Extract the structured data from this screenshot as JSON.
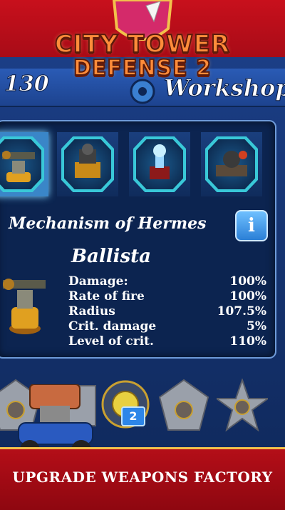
{
  "logo": {
    "line1": "CITY TOWER",
    "line2": "DEFENSE 2"
  },
  "header": {
    "coins": "130",
    "title": "Workshop"
  },
  "weapon_slots": [
    {
      "name": "ballista",
      "selected": true
    },
    {
      "name": "cannon",
      "selected": false
    },
    {
      "name": "tesla",
      "selected": false
    },
    {
      "name": "mortar",
      "selected": false
    }
  ],
  "detail": {
    "weapon_name": "Mechanism of Hermes",
    "info_label": "i",
    "tower_name": "Ballista",
    "stats": [
      {
        "label": "Damage:",
        "value": "100%"
      },
      {
        "label": "Rate of fire",
        "value": "100%"
      },
      {
        "label": "Radius",
        "value": "107.5%"
      },
      {
        "label": "Crit. damage",
        "value": "5%"
      },
      {
        "label": "Level of crit.",
        "value": "110%"
      }
    ]
  },
  "upgrades": {
    "badge_count": "2"
  },
  "footer": {
    "caption": "UPGRADE WEAPONS FACTORY"
  },
  "colors": {
    "accent": "#39c8d8",
    "footer_red": "#b40e18",
    "gold": "#f2c14b"
  }
}
